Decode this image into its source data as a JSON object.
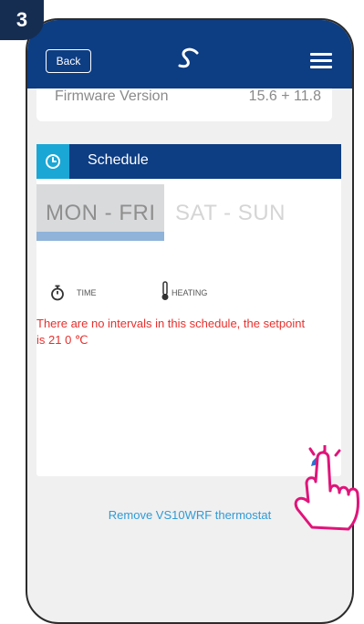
{
  "step_number": "3",
  "header": {
    "back_label": "Back",
    "logo_icon": "salus-logo-icon",
    "menu_icon": "hamburger-menu-icon",
    "bg_color": "#0d3d83"
  },
  "firmware": {
    "label": "Firmware Version",
    "value": "15.6 + 11.8"
  },
  "schedule": {
    "title": "Schedule",
    "icon": "schedule-clock-icon",
    "icon_color": "#1aa7d6",
    "tabs": [
      {
        "label": "MON - FRI",
        "selected": true
      },
      {
        "label": "SAT - SUN",
        "selected": false
      }
    ],
    "columns": {
      "time": "TIME",
      "heating": "HEATING"
    },
    "message": "There are no intervals in this schedule, the setpoint is 21 0 ℃",
    "message_color": "#e8302d",
    "edit_icon": "pencil-edit-icon"
  },
  "remove_link": "Remove VS10WRF thermostat",
  "accent_color": "#2f9bd6",
  "pointer_icon": "hand-pointer-icon"
}
